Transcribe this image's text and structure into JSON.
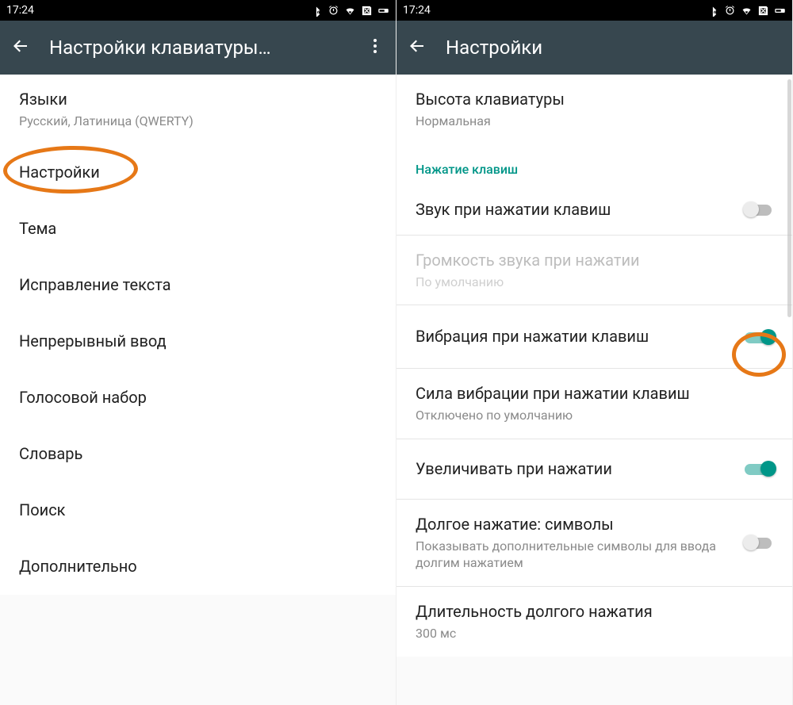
{
  "statusbar": {
    "time": "17:24"
  },
  "left": {
    "appbar_title": "Настройки клавиатуры…",
    "items": {
      "languages": {
        "title": "Языки",
        "sub": "Русский, Латиница (QWERTY)"
      },
      "settings": "Настройки",
      "theme": "Тема",
      "text_correction": "Исправление текста",
      "gesture_typing": "Непрерывный ввод",
      "voice_typing": "Голосовой набор",
      "dictionary": "Словарь",
      "search": "Поиск",
      "advanced": "Дополнительно"
    }
  },
  "right": {
    "appbar_title": "Настройки",
    "keyboard_height": {
      "title": "Высота клавиатуры",
      "sub": "Нормальная"
    },
    "section_keypress": "Нажатие клавиш",
    "sound_on_keypress": "Звук при нажатии клавиш",
    "volume": {
      "title": "Громкость звука при нажатии",
      "sub": "По умолчанию"
    },
    "vibrate": "Вибрация при нажатии клавиш",
    "vibration_strength": {
      "title": "Сила вибрации при нажатии клавиш",
      "sub": "Отключено по умолчанию"
    },
    "popup_on_press": "Увеличивать при нажатии",
    "long_press_symbols": {
      "title": "Долгое нажатие: символы",
      "sub": "Показывать дополнительные символы для ввода долгим нажатием"
    },
    "long_press_delay": {
      "title": "Длительность долгого нажатия",
      "sub": "300 мс"
    }
  },
  "switches": {
    "sound": false,
    "vibrate": true,
    "popup": true,
    "long_press_symbols": false
  },
  "colors": {
    "accent": "#009688",
    "appbar": "#37474f",
    "highlight": "#e67817"
  }
}
